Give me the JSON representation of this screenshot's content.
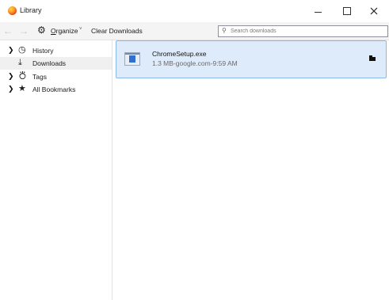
{
  "window": {
    "title": "Library"
  },
  "toolbar": {
    "organize_accesskey": "O",
    "organize_rest": "rganize",
    "clear_downloads_label": "Clear Downloads",
    "search_placeholder": "Search downloads",
    "search_value": ""
  },
  "sidebar": {
    "items": [
      {
        "label": "History",
        "icon": "clock-icon",
        "expandable": true
      },
      {
        "label": "Downloads",
        "icon": "download-arrow-icon",
        "expandable": false,
        "selected": true
      },
      {
        "label": "Tags",
        "icon": "tag-icon",
        "expandable": true
      },
      {
        "label": "All Bookmarks",
        "icon": "star-icon",
        "expandable": true
      }
    ]
  },
  "downloads": [
    {
      "filename": "ChromeSetup.exe",
      "status": "1.3 MB-google.com-9:59 AM",
      "icon": "exe-file-icon",
      "action_icon": "folder-icon"
    }
  ],
  "colors": {
    "selected_download_bg": "#deebfb",
    "selected_download_border": "#8ab7ea",
    "toolbar_bg": "#f4f4f4"
  }
}
